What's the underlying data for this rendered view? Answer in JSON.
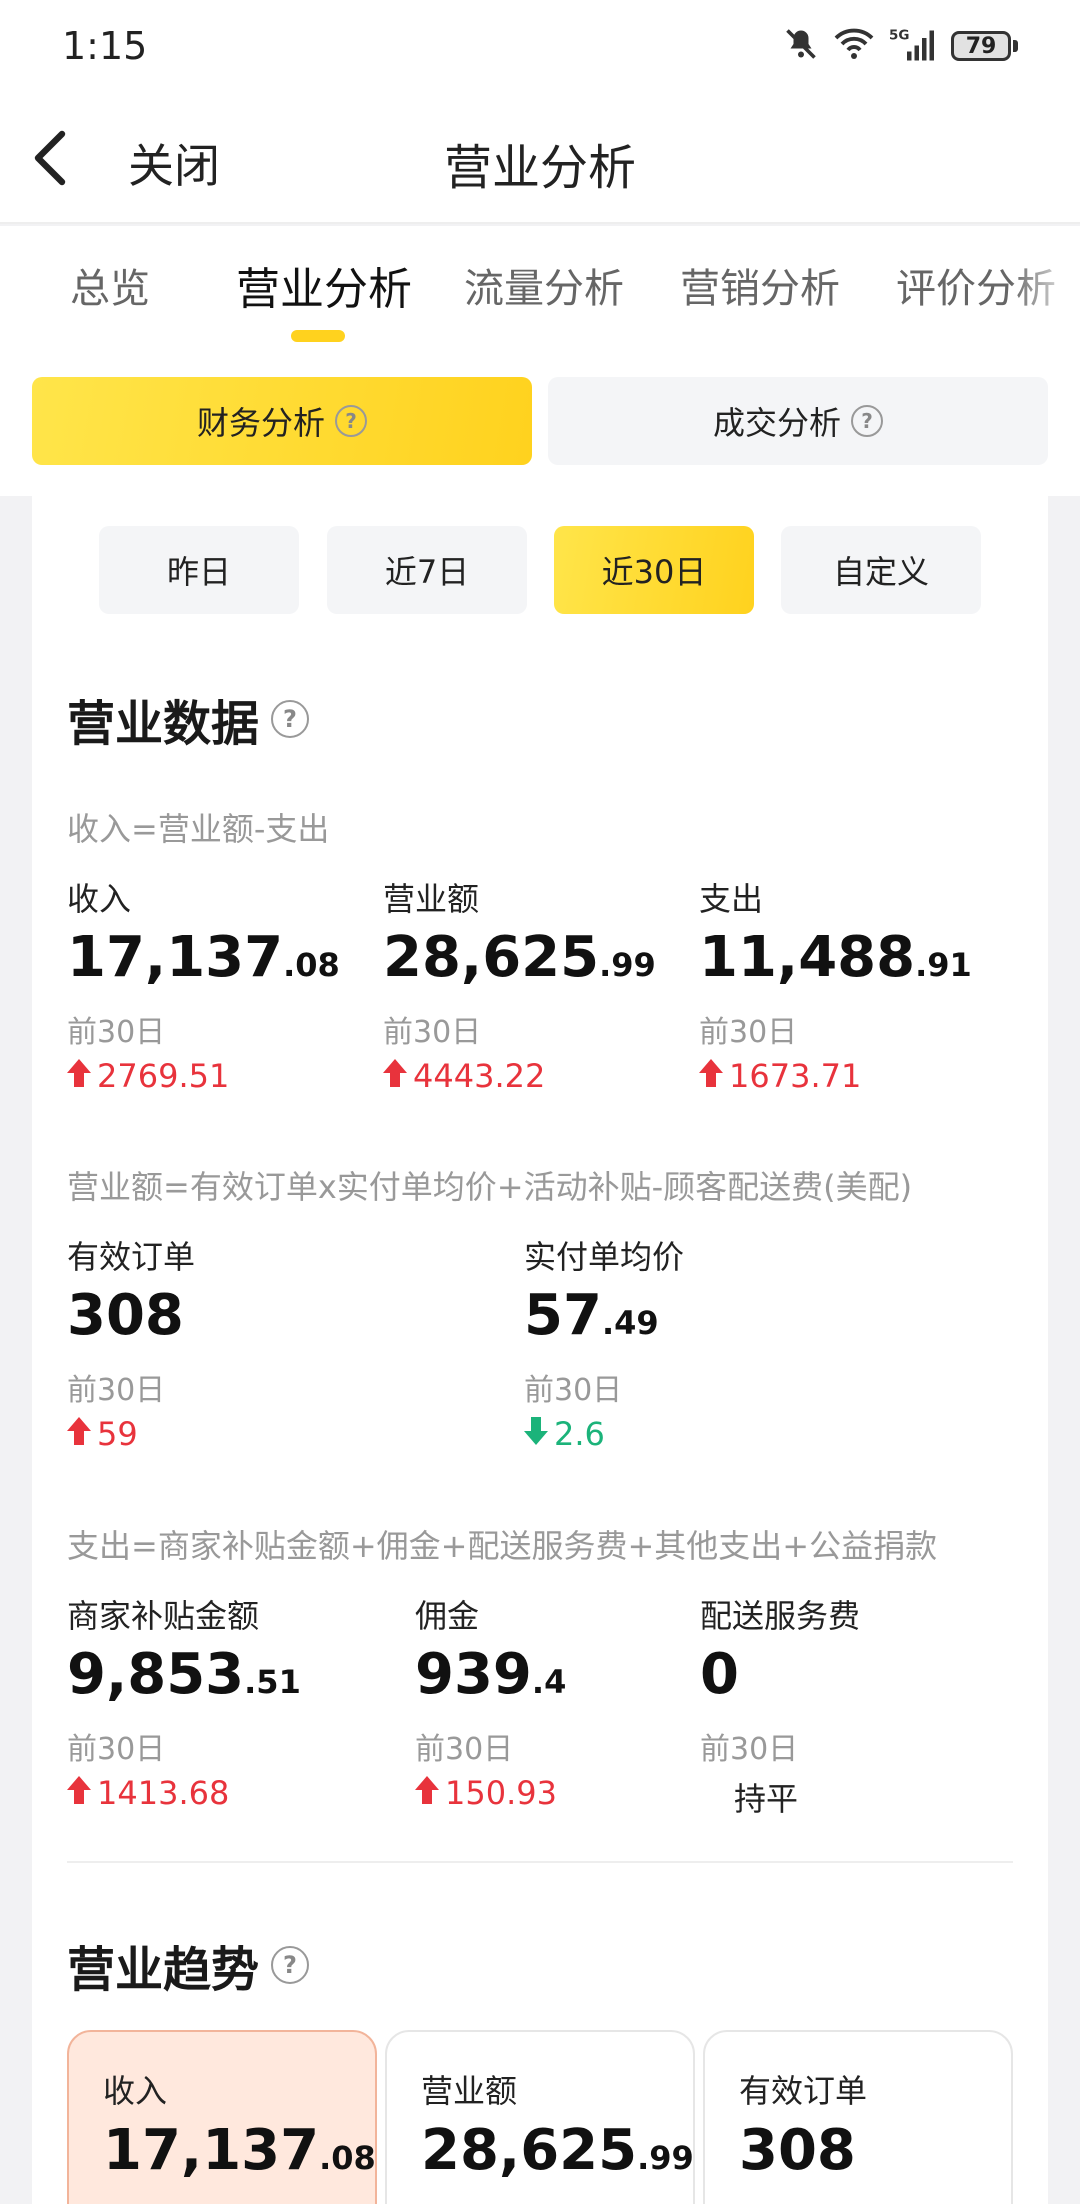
{
  "status_bar": {
    "time": "1:15",
    "battery": "79"
  },
  "navbar": {
    "close_label": "关闭",
    "title": "营业分析"
  },
  "tabs": [
    {
      "label": "总览",
      "active": false
    },
    {
      "label": "营业分析",
      "active": true
    },
    {
      "label": "流量分析",
      "active": false
    },
    {
      "label": "营销分析",
      "active": false
    },
    {
      "label": "评价分析",
      "active": false
    }
  ],
  "segments": [
    {
      "label": "财务分析",
      "active": true
    },
    {
      "label": "成交分析",
      "active": false
    }
  ],
  "periods": [
    {
      "label": "昨日",
      "active": false
    },
    {
      "label": "近7日",
      "active": false
    },
    {
      "label": "近30日",
      "active": true
    },
    {
      "label": "自定义",
      "active": false
    }
  ],
  "business_data": {
    "title": "营业数据",
    "group1": {
      "formula": "收入=营业额-支出",
      "metrics": [
        {
          "label": "收入",
          "int": "17,137",
          "dec": ".08",
          "prev_label": "前30日",
          "change": "2769.51",
          "direction": "up"
        },
        {
          "label": "营业额",
          "int": "28,625",
          "dec": ".99",
          "prev_label": "前30日",
          "change": "4443.22",
          "direction": "up"
        },
        {
          "label": "支出",
          "int": "11,488",
          "dec": ".91",
          "prev_label": "前30日",
          "change": "1673.71",
          "direction": "up"
        }
      ]
    },
    "group2": {
      "formula": "营业额=有效订单x实付单均价+活动补贴-顾客配送费(美配)",
      "metrics": [
        {
          "label": "有效订单",
          "int": "308",
          "dec": "",
          "prev_label": "前30日",
          "change": "59",
          "direction": "up"
        },
        {
          "label": "实付单均价",
          "int": "57",
          "dec": ".49",
          "prev_label": "前30日",
          "change": "2.6",
          "direction": "down"
        }
      ]
    },
    "group3": {
      "formula": "支出=商家补贴金额+佣金+配送服务费+其他支出+公益捐款",
      "metrics": [
        {
          "label": "商家补贴金额",
          "int": "9,853",
          "dec": ".51",
          "prev_label": "前30日",
          "change": "1413.68",
          "direction": "up"
        },
        {
          "label": "佣金",
          "int": "939",
          "dec": ".4",
          "prev_label": "前30日",
          "change": "150.93",
          "direction": "up"
        },
        {
          "label": "配送服务费",
          "int": "0",
          "dec": "",
          "prev_label": "前30日",
          "change": "持平",
          "direction": "flat"
        }
      ]
    }
  },
  "trend": {
    "title": "营业趋势",
    "cards": [
      {
        "label": "收入",
        "int": "17,137",
        "dec": ".08",
        "active": true
      },
      {
        "label": "营业额",
        "int": "28,625",
        "dec": ".99",
        "active": false
      },
      {
        "label": "有效订单",
        "int": "308",
        "dec": "",
        "active": false
      }
    ]
  },
  "colors": {
    "accent": "#ffd21e",
    "up": "#e8333c",
    "down": "#1bb37a",
    "muted": "#999999"
  }
}
